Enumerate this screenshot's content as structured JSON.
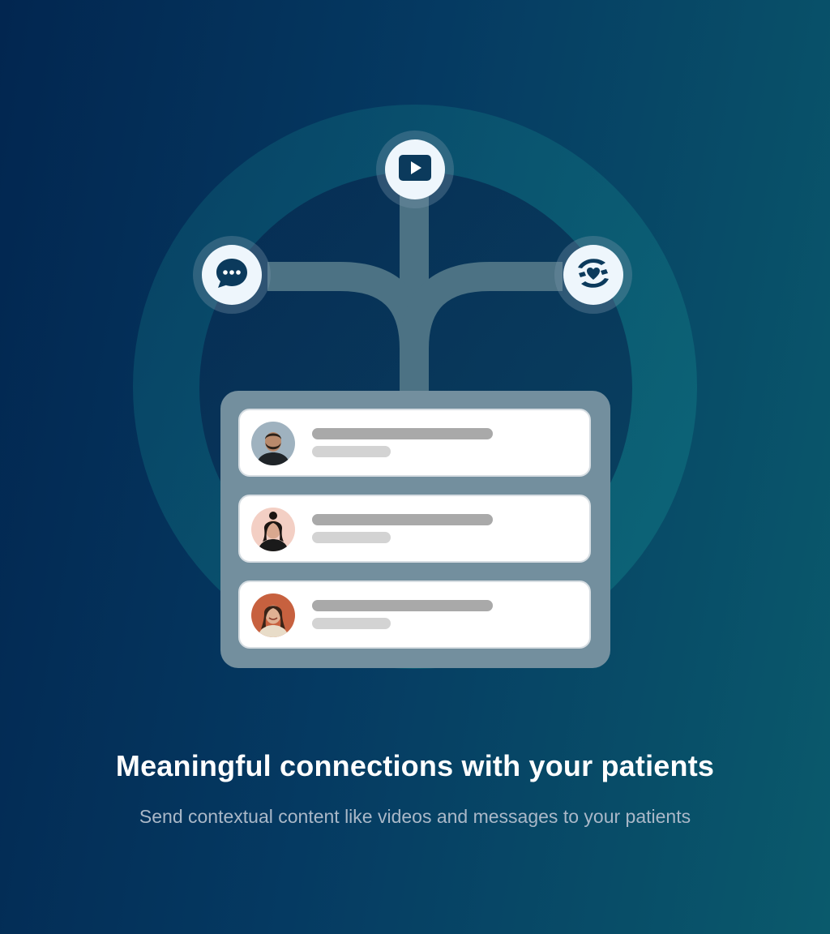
{
  "colors": {
    "background_start": "#022650",
    "background_end": "#0a5a6c",
    "icon_dark": "#0b3a5c",
    "panel": "#738f9e",
    "bar_long": "#a9a9a9",
    "bar_short": "#d3d3d3"
  },
  "icons": {
    "top": "play-video-icon",
    "left": "chat-message-icon",
    "right": "caring-hands-heart-icon"
  },
  "cards": [
    {
      "avatar": "patient-avatar-man-beard"
    },
    {
      "avatar": "patient-avatar-woman-hair-bun"
    },
    {
      "avatar": "patient-avatar-woman-smiling"
    }
  ],
  "text": {
    "headline": "Meaningful connections with your patients",
    "subline": "Send contextual content like videos and messages to your patients"
  }
}
